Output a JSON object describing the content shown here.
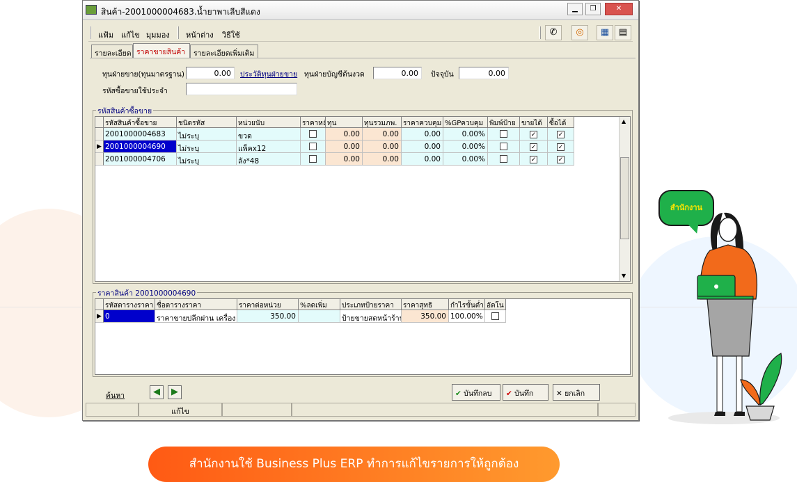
{
  "window": {
    "title": "สินค้า-2001000004683.น้ำยาพาเลีบสีแดง",
    "minimize": "▁",
    "restore": "❐",
    "close": "✕"
  },
  "menu": {
    "items": [
      "แฟ้ม",
      "แก้ไข",
      "มุมมอง",
      "หน้าต่าง",
      "วิธีใช้"
    ]
  },
  "toolbar": {
    "icons": [
      "telephone-icon",
      "target-icon",
      "calculator-icon",
      "clipboard-icon"
    ]
  },
  "tabs": [
    {
      "label": "รายละเอียด"
    },
    {
      "label": "ราคาขายสินค้า"
    },
    {
      "label": "รายละเอียดเพิ่มเติม"
    }
  ],
  "form": {
    "std_cost_label": "ทุนฝ่ายขาย(ทุนมาตรฐาน)",
    "std_cost_value": "0.00",
    "cost_history_link": "ประวัติทุนฝ่ายขาย",
    "acct_cost_label": "ทุนฝ่ายบัญชีต้นงวด",
    "acct_cost_value": "0.00",
    "current_label": "ปัจจุบัน",
    "current_value": "0.00",
    "buy_code_label": "รหัสซื้อขายใช้ประจำ",
    "buy_code_value": ""
  },
  "codes_group": {
    "title": "รหัสสินค้าซื้อขาย",
    "headers": [
      "รหัสสินค้าซื้อขาย",
      "ชนิดรหัส",
      "หน่วยนับ",
      "ราคาหลั",
      "ทุน",
      "ทุนรวมภพ.",
      "ราคาควบคุม",
      "%GPควบคุม",
      "พิมพ์ป้าย",
      "ขายได้",
      "ซื้อได้"
    ],
    "rows": [
      {
        "code": "2001000004683",
        "type": "ไม่ระบุ",
        "unit": "ขวด",
        "main_price": false,
        "cost": "0.00",
        "cost_vat": "0.00",
        "ctrl_price": "0.00",
        "gp": "0.00%",
        "print": false,
        "sell": true,
        "buy": true
      },
      {
        "code": "2001000004690",
        "type": "ไม่ระบุ",
        "unit": "แพ็คx12",
        "main_price": false,
        "cost": "0.00",
        "cost_vat": "0.00",
        "ctrl_price": "0.00",
        "gp": "0.00%",
        "print": false,
        "sell": true,
        "buy": true
      },
      {
        "code": "2001000004706",
        "type": "ไม่ระบุ",
        "unit": "ลัง*48",
        "main_price": false,
        "cost": "0.00",
        "cost_vat": "0.00",
        "ctrl_price": "0.00",
        "gp": "0.00%",
        "print": false,
        "sell": true,
        "buy": true
      }
    ]
  },
  "price_group": {
    "title": "ราคาสินค้า 2001000004690",
    "headers": [
      "รหัสตารางราคา",
      "ชื่อตารางราคา",
      "ราคาต่อหน่วย",
      "%ลดเพิ่ม",
      "ประเภทป้ายราคา",
      "ราคาสุทธิ",
      "กำไรขั้นต่ำ",
      "อัตโน"
    ],
    "rows": [
      {
        "code": "0",
        "name": "ราคาขายปลีกผ่าน เครื่อง P",
        "unit_price": "350.00",
        "discount": "",
        "label_type": "ป้ายขายสดหน้าร้าน",
        "net": "350.00",
        "min_profit": "100.00%",
        "auto": false
      }
    ]
  },
  "bottom": {
    "search_link": "ค้นหา",
    "save_delete": "บันทึกลบ",
    "save": "บันทึก",
    "cancel": "ยกเลิก"
  },
  "status": {
    "mode": "แก้ไข"
  },
  "bubble": {
    "text": "สำนักงาน"
  },
  "banner": {
    "text": "สำนักงานใช้ Business Plus ERP ทำการแก้ไขรายการให้ถูกต้อง"
  }
}
